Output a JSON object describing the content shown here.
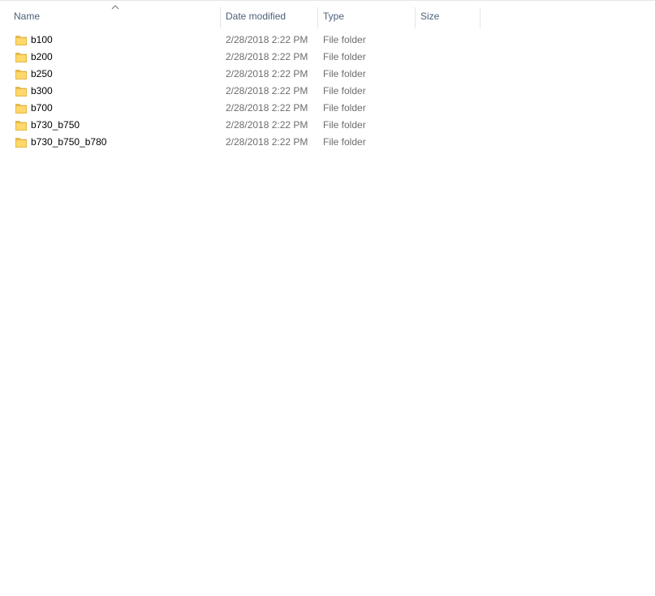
{
  "columns": {
    "name": "Name",
    "date": "Date modified",
    "type": "Type",
    "size": "Size"
  },
  "sort": {
    "column": "name",
    "icon": "chevron-up-icon"
  },
  "files": [
    {
      "name": "b100",
      "date": "2/28/2018 2:22 PM",
      "type": "File folder",
      "size": "",
      "icon": "folder-icon"
    },
    {
      "name": "b200",
      "date": "2/28/2018 2:22 PM",
      "type": "File folder",
      "size": "",
      "icon": "folder-icon"
    },
    {
      "name": "b250",
      "date": "2/28/2018 2:22 PM",
      "type": "File folder",
      "size": "",
      "icon": "folder-icon"
    },
    {
      "name": "b300",
      "date": "2/28/2018 2:22 PM",
      "type": "File folder",
      "size": "",
      "icon": "folder-icon"
    },
    {
      "name": "b700",
      "date": "2/28/2018 2:22 PM",
      "type": "File folder",
      "size": "",
      "icon": "folder-icon"
    },
    {
      "name": "b730_b750",
      "date": "2/28/2018 2:22 PM",
      "type": "File folder",
      "size": "",
      "icon": "folder-icon"
    },
    {
      "name": "b730_b750_b780",
      "date": "2/28/2018 2:22 PM",
      "type": "File folder",
      "size": "",
      "icon": "folder-icon"
    }
  ],
  "colors": {
    "header_text": "#4c607a",
    "secondary_text": "#6d6d6d",
    "folder_fill": "#ffd86b",
    "folder_edge": "#e2b43c"
  }
}
